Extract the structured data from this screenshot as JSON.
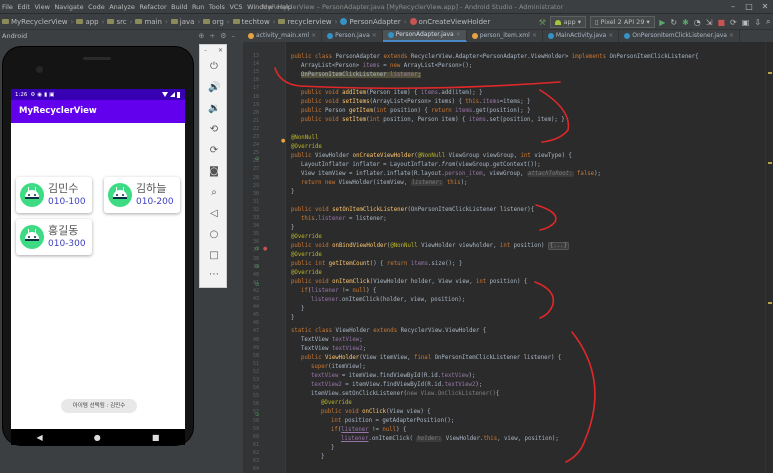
{
  "ide": {
    "window_title": "MyRecyclerView – PersonAdapter.java [MyRecyclerView.app] - Android Studio - Administrator",
    "menu": [
      "File",
      "Edit",
      "View",
      "Navigate",
      "Code",
      "Analyze",
      "Refactor",
      "Build",
      "Run",
      "Tools",
      "VCS",
      "Window",
      "Help"
    ],
    "breadcrumbs": [
      "MyRecyclerView",
      "app",
      "src",
      "main",
      "java",
      "org",
      "techtow",
      "recyclerview",
      "PersonAdapter",
      "onCreateViewHolder"
    ],
    "run_config": "app",
    "device": "Pixel 2 API 29",
    "project_label": "Android",
    "tabs": [
      "activity_main.xml",
      "Person.java",
      "PersonAdapter.java",
      "person_item.xml",
      "MainActivity.java",
      "OnPersonItemClickListener.java"
    ],
    "active_tab": "PersonAdapter.java"
  },
  "gutter": {
    "line_numbers": [
      "13",
      "14",
      "15",
      "16",
      "17",
      "18",
      "19",
      "20",
      "21",
      "22",
      "23",
      "24",
      "25",
      "26",
      "27",
      "28",
      "29",
      "30",
      "31",
      "32",
      "33",
      "34",
      "35",
      "36",
      "37",
      "38",
      "39",
      "40",
      "41",
      "42",
      "43",
      "44",
      "45",
      "46",
      "47",
      "48",
      "49",
      "50",
      "51",
      "52",
      "53",
      "54",
      "55",
      "56",
      "57",
      "58",
      "59",
      "60",
      "61",
      "62",
      "63",
      "64"
    ]
  },
  "code": {
    "l1": "public class PersonAdapter extends RecyclerView.Adapter<PersonAdapter.ViewHolder> implements OnPersonItemClickListener{",
    "l2": "ArrayList<Person> items = new ArrayList<Person>();",
    "l3": "OnPersonItemClickListener listener;",
    "l4": "public void addItem(Person item) { items.add(item); }",
    "l5": "public void setItems(ArrayList<Person> items) { this.items=items; }",
    "l6": "public Person getItem(int position) { return items.get(position); }",
    "l7": "public void setItem(int position, Person item) { items.set(position, item); }",
    "l8": "@NonNull",
    "l9": "@Override",
    "l10": "public ViewHolder onCreateViewHolder(@NonNull ViewGroup viewGroup, int viewType) {",
    "l11": "LayoutInflater inflater = LayoutInflater.from(viewGroup.getContext());",
    "l12a": "View itemView = inflater.inflate(R.layout.person_item, viewGroup,",
    "l12h": "attachToRoot:",
    "l12b": "false);",
    "l13a": "return new ViewHolder(itemView,",
    "l13h": "listener:",
    "l13b": "this);",
    "l14": "}",
    "l15": "public void setOnItemClickListener(OnPersonItemClickListener listener){",
    "l16": "this.listener = listener;",
    "l17": "}",
    "l18": "@Override",
    "l19": "public void onBindViewHolder(@NonNull ViewHolder viewholder, int position) {...}",
    "l20": "@Override",
    "l21": "public int getItemCount() { return items.size(); }",
    "l22": "@Override",
    "l23": "public void onItemClick(ViewHolder holder, View view, int position) {",
    "l24": "if(listener != null) {",
    "l25": "listener.onItemClick(holder, view, position);",
    "l26": "}",
    "l27": "}",
    "l28": "static class ViewHolder extends RecyclerView.ViewHolder {",
    "l29": "TextView textView;",
    "l30": "TextView textView2;",
    "l31": "public ViewHolder(View itemView, final OnPersonItemClickListener listener) {",
    "l32": "super(itemView);",
    "l33": "textView = itemView.findViewById(R.id.textView);",
    "l34": "textView2 = itemView.findViewById(R.id.textView2);",
    "l35": "itemView.setOnClickListener(new View.OnClickListener(){",
    "l36": "@Override",
    "l37": "public void onClick(View view) {",
    "l38": "int position = getAdapterPosition();",
    "l39": "if(listener != null) {",
    "l40a": "listener.onItemClick(",
    "l40h": "holder:",
    "l40b": "ViewHolder.this, view, position);",
    "l41": "}",
    "l42": "}"
  },
  "phone": {
    "time": "1:26",
    "app_title": "MyRecyclerView",
    "cards": [
      {
        "name": "김민수",
        "phone": "010-100"
      },
      {
        "name": "김하늘",
        "phone": "010-200"
      },
      {
        "name": "홍길동",
        "phone": "010-300"
      }
    ],
    "toast": "아이템 선택됨 : 김민수"
  },
  "colors": {
    "status_bar": "#3700b3",
    "app_bar": "#6200ee",
    "annotation": "#e0282a"
  }
}
